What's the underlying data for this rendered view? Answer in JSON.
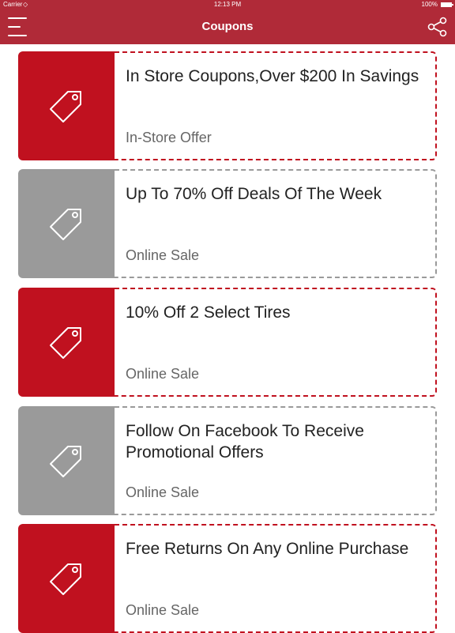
{
  "status_bar": {
    "carrier": "Carrier",
    "time": "12:13 PM",
    "battery": "100%"
  },
  "nav": {
    "title": "Coupons",
    "menu_icon": "hamburger-menu-icon",
    "share_icon": "share-icon"
  },
  "colors": {
    "brand": "#b02a38",
    "accent_red": "#c0111f",
    "muted_gray": "#9a9a9a"
  },
  "coupons": [
    {
      "title": "In Store Coupons,Over $200 In Savings",
      "type": "In-Store Offer",
      "style": "red",
      "icon": "price-tag-icon"
    },
    {
      "title": "Up To 70% Off Deals Of The Week",
      "type": "Online Sale",
      "style": "gray",
      "icon": "price-tag-icon"
    },
    {
      "title": "10% Off 2 Select Tires",
      "type": "Online Sale",
      "style": "red",
      "icon": "price-tag-icon"
    },
    {
      "title": "Follow On Facebook To Receive Promotional Offers",
      "type": "Online Sale",
      "style": "gray",
      "icon": "price-tag-icon"
    },
    {
      "title": "Free Returns On Any Online Purchase",
      "type": "Online Sale",
      "style": "red",
      "icon": "price-tag-icon"
    }
  ]
}
